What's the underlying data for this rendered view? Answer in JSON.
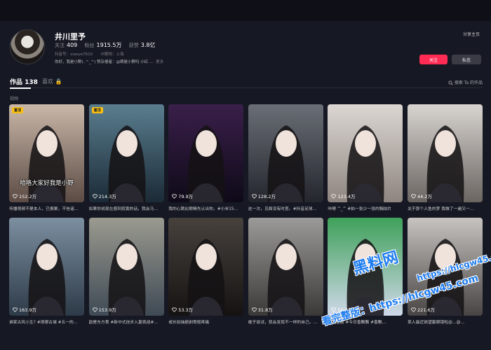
{
  "profile": {
    "name": "井川里予",
    "follow_label": "关注",
    "follow_count": "409",
    "fans_label": "粉丝",
    "fans_count": "1915.5万",
    "likes_label": "获赞",
    "likes_count": "3.8亿",
    "douyin_id": "抖音号：xiaoye7610",
    "ip": "IP属地：上海",
    "bio": "你好，我是小野(..^_^) 赞杂便者：@晒是小野吗 小红 ...",
    "bio_more": "更多",
    "share": "分享主页",
    "follow_button": "关注",
    "message_button": "私信"
  },
  "tabs": {
    "works": "作品 138",
    "likes": "喜欢 🔒",
    "search": "搜索 Ta 的作品"
  },
  "section_label": "视频",
  "videos": [
    {
      "likes": "152.2万",
      "caption": "传播视频不是本人，已报案，不信谣…",
      "pinned": "置顶",
      "overlay": "哈咯大家好我是小野"
    },
    {
      "likes": "214.3万",
      "caption": "如果你说现在感到寂寞的话，我会马…",
      "pinned": "置顶",
      "overlay": ""
    },
    {
      "likes": "79.9万",
      "caption": "我的心跳比眼睛先认出你。#小米15…",
      "pinned": "",
      "overlay": ""
    },
    {
      "likes": "128.2万",
      "caption": "这一次，见面没有时差。#抖音足球…",
      "pinned": "",
      "overlay": ""
    },
    {
      "likes": "123.4万",
      "caption": "咔嚓 ^_^ #拍一张少一张的胸拍片",
      "pinned": "",
      "overlay": ""
    },
    {
      "likes": "44.2万",
      "caption": "关于那个人鱼的梦 我做了一遍又一…",
      "pinned": "",
      "overlay": ""
    },
    {
      "likes": "163.9万",
      "caption": "谁家古风小生? #琅琊古城 #五一的…",
      "pinned": "",
      "overlay": ""
    },
    {
      "likes": "153.9万",
      "caption": "韵是东方骨 #新中式信步入夏挑战#…",
      "pinned": "",
      "overlay": ""
    },
    {
      "likes": "53.3万",
      "caption": "或长如抽筋剥骨般疼痛",
      "pinned": "",
      "overlay": ""
    },
    {
      "likes": "31.8万",
      "caption": "敢于尝试，就会发现不一样的自己。…",
      "pinned": "",
      "overlay": ""
    },
    {
      "likes": "50.4万",
      "caption": "看完整版 #今日香飘飘 #香飘…",
      "pinned": "",
      "overlay": ""
    },
    {
      "likes": "221.6万",
      "caption": "某人最近欲望赢眼镜啦@…@…",
      "pinned": "",
      "overlay": ""
    }
  ],
  "watermark": {
    "line1": "黑料网",
    "line2": "https://hlcgw45.com",
    "line3": "看完整版：https://hlcgw45.com"
  },
  "colors": {
    "background": "#161823",
    "accent": "#fe2c55",
    "pin": "#fac012"
  }
}
